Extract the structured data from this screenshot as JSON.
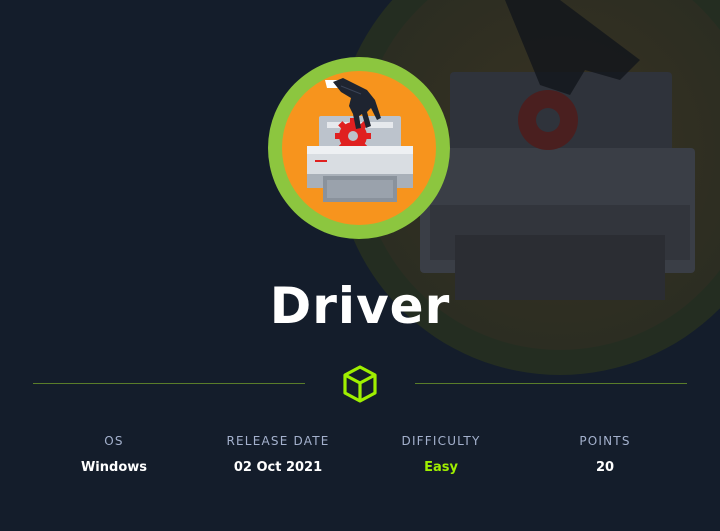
{
  "machine": {
    "name": "Driver",
    "logo_icon": "printer-with-gloved-hand-icon",
    "divider_icon": "cube-icon"
  },
  "stats": [
    {
      "label": "OS",
      "value": "Windows"
    },
    {
      "label": "RELEASE DATE",
      "value": "02 Oct 2021"
    },
    {
      "label": "DIFFICULTY",
      "value": "Easy"
    },
    {
      "label": "POINTS",
      "value": "20"
    }
  ],
  "colors": {
    "background": "#141d2b",
    "accent_green": "#9fef00",
    "difficulty_easy": "#9fef00",
    "label_gray": "#a4b1cd",
    "logo_ring": "#8cc63f",
    "logo_fill": "#f7941d"
  }
}
